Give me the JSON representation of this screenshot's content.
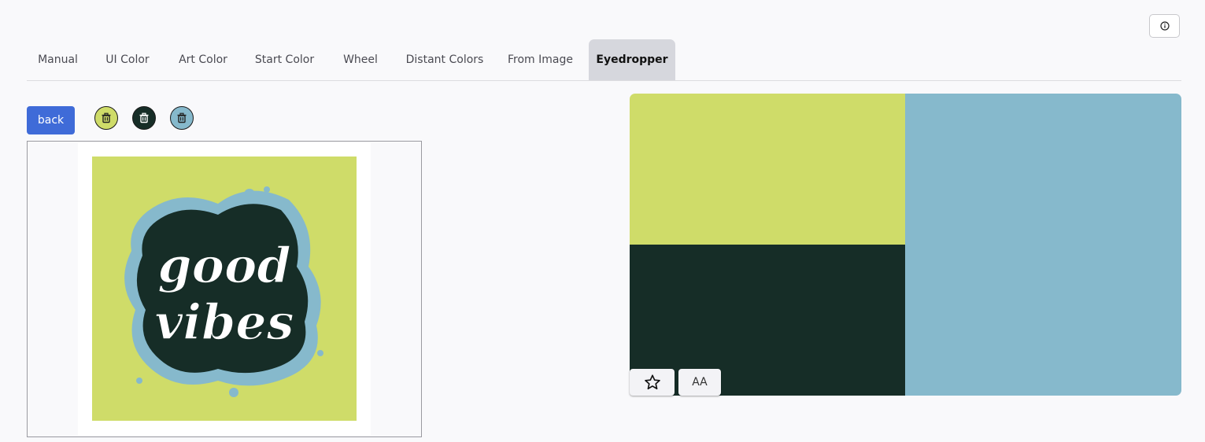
{
  "header": {
    "info_icon": "info-circle-icon"
  },
  "tabs": [
    {
      "label": "Manual",
      "active": false
    },
    {
      "label": "UI Color",
      "active": false
    },
    {
      "label": "Art Color",
      "active": false
    },
    {
      "label": "Start Color",
      "active": false
    },
    {
      "label": "Wheel",
      "active": false
    },
    {
      "label": "Distant Colors",
      "active": false
    },
    {
      "label": "From Image",
      "active": false
    },
    {
      "label": "Eyedropper",
      "active": true
    }
  ],
  "toolbar": {
    "back_label": "back",
    "picked_colors": [
      {
        "color": "#cfdc69",
        "icon": "trash-icon"
      },
      {
        "color": "#162d27",
        "icon": "trash-icon"
      },
      {
        "color": "#86b9cc",
        "icon": "trash-icon"
      }
    ]
  },
  "image": {
    "artwork_text": "good vibes",
    "background": "#cfdc69"
  },
  "palette": {
    "colors": [
      "#cfdc69",
      "#162d27",
      "#86b9cc"
    ],
    "favorite_icon": "star-icon",
    "contrast_label": "AA"
  }
}
